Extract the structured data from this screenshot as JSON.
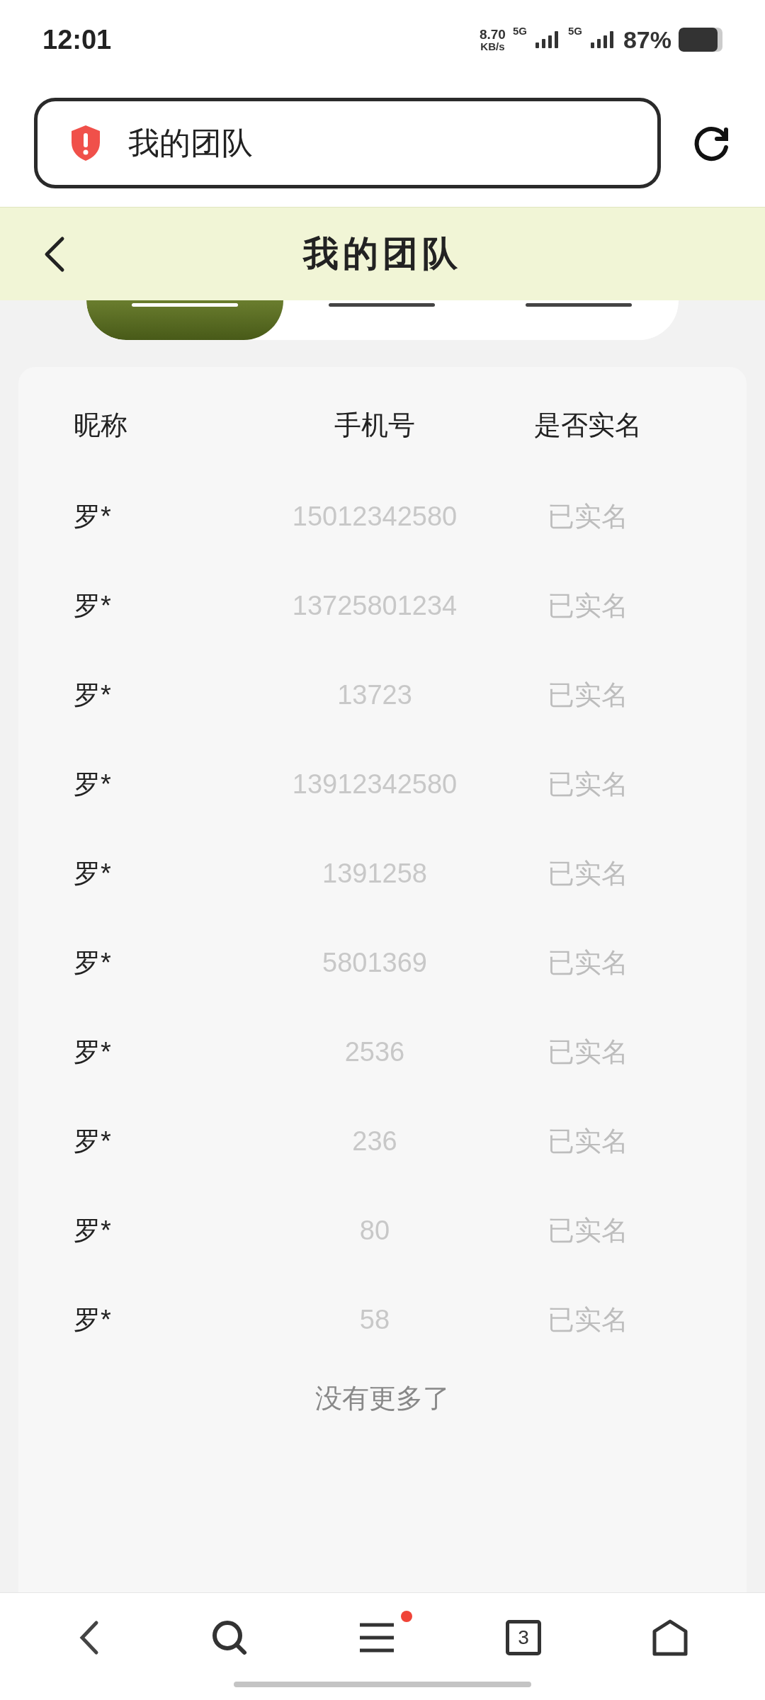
{
  "status_bar": {
    "time": "12:01",
    "speed": "8.70",
    "speed_unit": "KB/s",
    "sim1": "5G",
    "sim2": "5G",
    "battery": "87%"
  },
  "address_bar": {
    "title": "我的团队"
  },
  "header": {
    "title": "我的团队"
  },
  "tabs": [
    {
      "selected": true
    },
    {
      "selected": false
    },
    {
      "selected": false
    }
  ],
  "table": {
    "columns": [
      "昵称",
      "手机号",
      "是否实名"
    ],
    "rows": [
      {
        "nickname": "罗*",
        "phone": "15012342580",
        "status": "已实名"
      },
      {
        "nickname": "罗*",
        "phone": "13725801234",
        "status": "已实名"
      },
      {
        "nickname": "罗*",
        "phone": "13723",
        "status": "已实名"
      },
      {
        "nickname": "罗*",
        "phone": "13912342580",
        "status": "已实名"
      },
      {
        "nickname": "罗*",
        "phone": "1391258",
        "status": "已实名"
      },
      {
        "nickname": "罗*",
        "phone": "5801369",
        "status": "已实名"
      },
      {
        "nickname": "罗*",
        "phone": "2536",
        "status": "已实名"
      },
      {
        "nickname": "罗*",
        "phone": "236",
        "status": "已实名"
      },
      {
        "nickname": "罗*",
        "phone": "80",
        "status": "已实名"
      },
      {
        "nickname": "罗*",
        "phone": "58",
        "status": "已实名"
      }
    ]
  },
  "footer_note": "没有更多了",
  "bottom_nav": {
    "tab_count": "3",
    "menu_badge": true
  }
}
